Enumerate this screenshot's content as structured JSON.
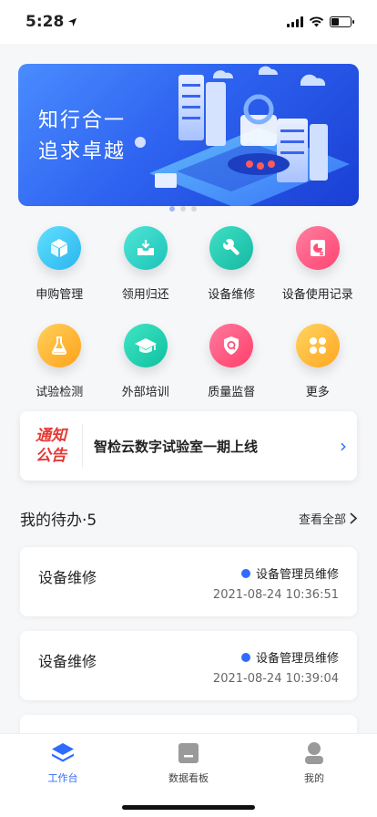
{
  "status_bar": {
    "time": "5:28"
  },
  "banner": {
    "line1": "知行合一",
    "line2": "追求卓越"
  },
  "grid": [
    {
      "label": "申购管理",
      "icon": "box-icon",
      "color": "#3ec9f0"
    },
    {
      "label": "领用归还",
      "icon": "tray-icon",
      "color": "#2fd3c7"
    },
    {
      "label": "设备维修",
      "icon": "wrench-icon",
      "color": "#25c9b3"
    },
    {
      "label": "设备使用记录",
      "icon": "chart-doc-icon",
      "color": "#ff5a86"
    },
    {
      "label": "试验检测",
      "icon": "flask-icon",
      "color": "#ffb020"
    },
    {
      "label": "外部培训",
      "icon": "grad-cap-icon",
      "color": "#1ec9a8"
    },
    {
      "label": "质量监督",
      "icon": "shield-icon",
      "color": "#ff4f7a"
    },
    {
      "label": "更多",
      "icon": "more-grid-icon",
      "color": "#ffb52a"
    }
  ],
  "notice": {
    "badge_line1": "通知",
    "badge_line2": "公告",
    "text": "智检云数字试验室一期上线",
    "arrow": "›"
  },
  "todo": {
    "title": "我的待办·5",
    "more": "查看全部",
    "items": [
      {
        "title": "设备维修",
        "role": "设备管理员维修",
        "time": "2021-08-24 10:36:51"
      },
      {
        "title": "设备维修",
        "role": "设备管理员维修",
        "time": "2021-08-24 10:39:04"
      }
    ]
  },
  "tabs": [
    {
      "label": "工作台",
      "icon": "layers-icon",
      "active": true
    },
    {
      "label": "数据看板",
      "icon": "board-icon",
      "active": false
    },
    {
      "label": "我的",
      "icon": "user-icon",
      "active": false
    }
  ],
  "colors": {
    "accent": "#2f6bff",
    "notice_red": "#e53935"
  }
}
